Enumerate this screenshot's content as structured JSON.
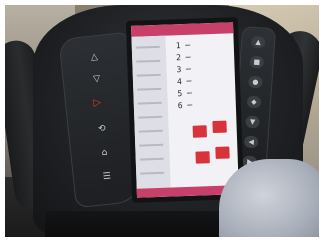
{
  "photo": {
    "subject": "treadmill console"
  },
  "console": {
    "left_keys": [
      "△",
      "▽",
      "▷",
      "⟲",
      "⌂",
      "☰"
    ],
    "right_keys": [
      "▲",
      "■",
      "●",
      "◆",
      "▼",
      "◀",
      "▶"
    ]
  },
  "screen": {
    "list_marks": [
      "1 ─",
      "2 ─",
      "3 ─",
      "4 ─",
      "5 ─",
      "6 ─"
    ]
  }
}
